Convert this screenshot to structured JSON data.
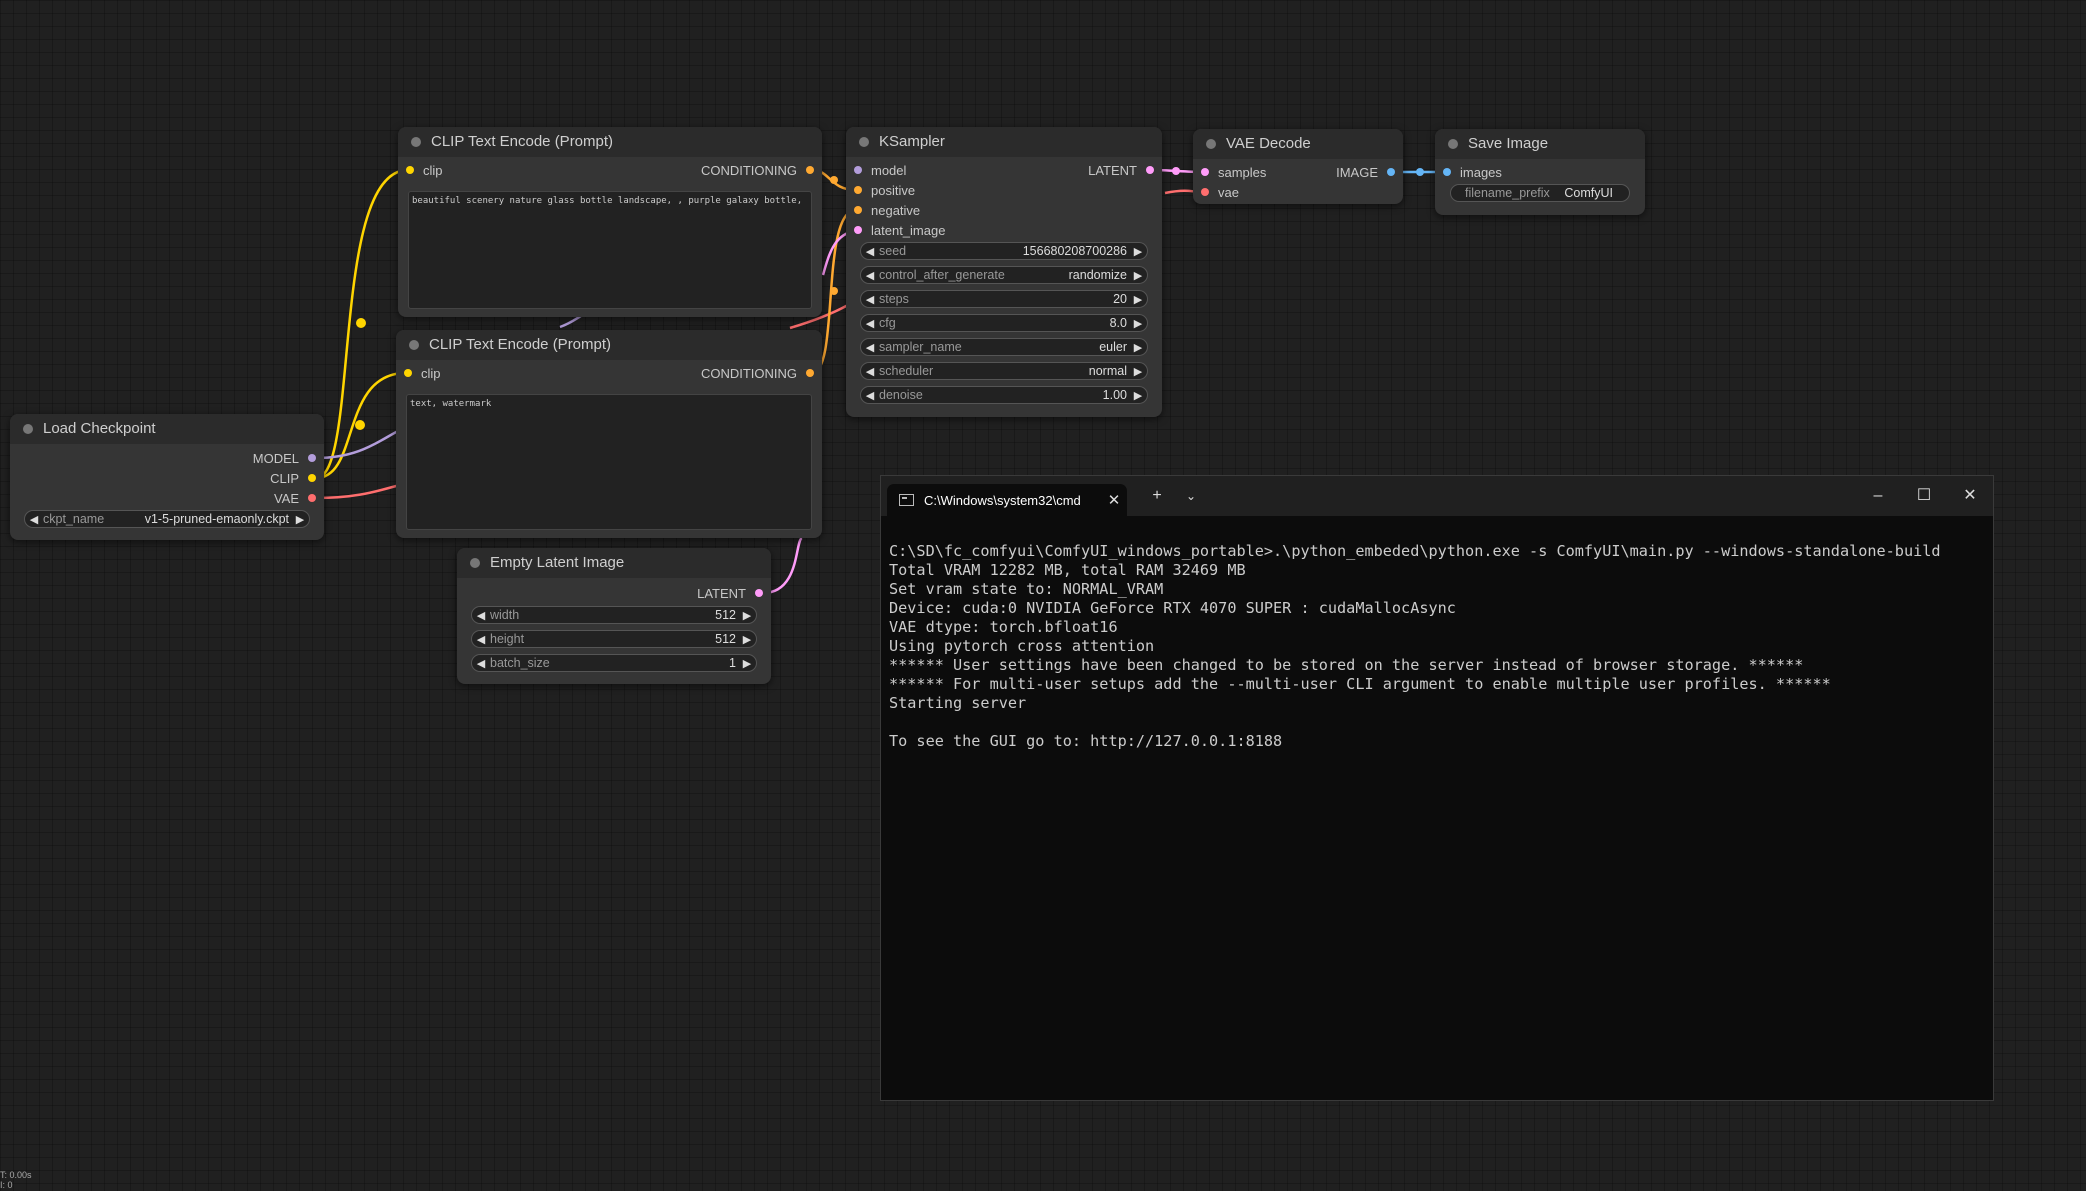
{
  "colors": {
    "clip": "#ffd500",
    "conditioning": "#ffa931",
    "model": "#b39ddb",
    "latent": "#ff9cf9",
    "vae": "#ff6e6e",
    "image": "#64b5f6"
  },
  "nodes": {
    "clip_pos": {
      "title": "CLIP Text Encode (Prompt)",
      "input_clip": "clip",
      "output": "CONDITIONING",
      "text": "beautiful scenery nature glass bottle landscape, , purple galaxy bottle,"
    },
    "clip_neg": {
      "title": "CLIP Text Encode (Prompt)",
      "input_clip": "clip",
      "output": "CONDITIONING",
      "text": "text, watermark"
    },
    "ksampler": {
      "title": "KSampler",
      "inputs": [
        "model",
        "positive",
        "negative",
        "latent_image"
      ],
      "output": "LATENT",
      "widgets": [
        {
          "label": "seed",
          "value": "156680208700286"
        },
        {
          "label": "control_after_generate",
          "value": "randomize"
        },
        {
          "label": "steps",
          "value": "20"
        },
        {
          "label": "cfg",
          "value": "8.0"
        },
        {
          "label": "sampler_name",
          "value": "euler"
        },
        {
          "label": "scheduler",
          "value": "normal"
        },
        {
          "label": "denoise",
          "value": "1.00"
        }
      ]
    },
    "vae_decode": {
      "title": "VAE Decode",
      "inputs": [
        "samples",
        "vae"
      ],
      "output": "IMAGE"
    },
    "save_image": {
      "title": "Save Image",
      "input": "images",
      "widget": {
        "label": "filename_prefix",
        "value": "ComfyUI"
      }
    },
    "load_checkpoint": {
      "title": "Load Checkpoint",
      "outputs": [
        "MODEL",
        "CLIP",
        "VAE"
      ],
      "widget": {
        "label": "ckpt_name",
        "value": "v1-5-pruned-emaonly.ckpt"
      }
    },
    "empty_latent": {
      "title": "Empty Latent Image",
      "output": "LATENT",
      "widgets": [
        {
          "label": "width",
          "value": "512"
        },
        {
          "label": "height",
          "value": "512"
        },
        {
          "label": "batch_size",
          "value": "1"
        }
      ]
    }
  },
  "terminal": {
    "tab_title": "C:\\Windows\\system32\\cmd",
    "lines": [
      "C:\\SD\\fc_comfyui\\ComfyUI_windows_portable>.\\python_embeded\\python.exe -s ComfyUI\\main.py --windows-standalone-build",
      "Total VRAM 12282 MB, total RAM 32469 MB",
      "Set vram state to: NORMAL_VRAM",
      "Device: cuda:0 NVIDIA GeForce RTX 4070 SUPER : cudaMallocAsync",
      "VAE dtype: torch.bfloat16",
      "Using pytorch cross attention",
      "****** User settings have been changed to be stored on the server instead of browser storage. ******",
      "****** For multi-user setups add the --multi-user CLI argument to enable multiple user profiles. ******",
      "Starting server",
      "",
      "To see the GUI go to: http://127.0.0.1:8188"
    ]
  },
  "status": {
    "time": "T: 0.00s",
    "count": "I: 0"
  }
}
